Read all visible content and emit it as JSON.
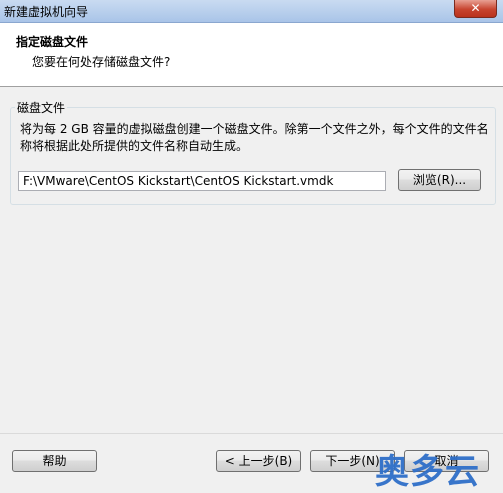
{
  "window": {
    "title": "新建虚拟机向导",
    "close_label": "✕"
  },
  "header": {
    "title": "指定磁盘文件",
    "subtitle": "您要在何处存储磁盘文件?"
  },
  "disk_group": {
    "label": "磁盘文件",
    "description": "将为每 2 GB 容量的虚拟磁盘创建一个磁盘文件。除第一个文件之外，每个文件的文件名称将根据此处所提供的文件名称自动生成。",
    "path_value": "F:\\VMware\\CentOS Kickstart\\CentOS Kickstart.vmdk",
    "browse_label": "浏览(R)..."
  },
  "footer": {
    "help_label": "帮助",
    "back_label": "< 上一步(B)",
    "next_label": "下一步(N)",
    "cancel_label": "取消"
  },
  "watermark": {
    "text": "奥多云"
  }
}
